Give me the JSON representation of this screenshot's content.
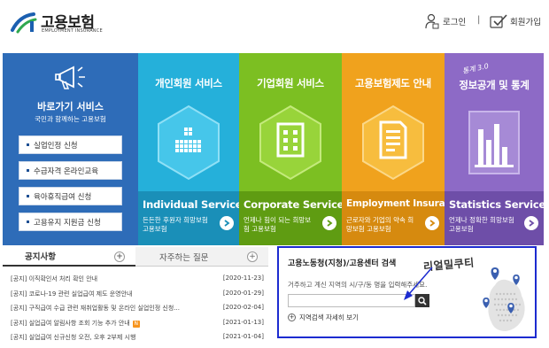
{
  "header": {
    "logo_title": "고용보험",
    "logo_sub": "EMPLOYMENT INSURANCE",
    "login_label": "로그인",
    "separator": "|",
    "join_label": "회원가입"
  },
  "quick": {
    "title": "바로가기 서비스",
    "subtitle": "국민과 함께하는 고용보험",
    "items": [
      {
        "label": "실업인정 신청"
      },
      {
        "label": "수급자격 온라인교육"
      },
      {
        "label": "육아휴직급여 신청"
      },
      {
        "label": "고용유지 지원금 신청"
      }
    ]
  },
  "panels": [
    {
      "title": "개인회원 서비스",
      "en_title": "Individual Service",
      "desc": "든든한 후원자 희망보험 고용보험"
    },
    {
      "title": "기업회원 서비스",
      "en_title": "Corporate Service",
      "desc": "언제나 힘이 되는 희망보험 고용보험"
    },
    {
      "title": "고용보험제도 안내",
      "en_title": "Employment Insurance",
      "desc": "근로자와 기업의 약속 희망보험 고용보험"
    },
    {
      "title": "정보공개 및 통계",
      "en_title": "Statistics Service",
      "desc": "언제나 정확한 희망보험 고용보험",
      "deco": "통계 3.0"
    }
  ],
  "tabs": {
    "notice": "공지사항",
    "faq": "자주하는 질문",
    "plus": "+"
  },
  "notices": [
    {
      "text": "[공지] 이직확인서 처리 확인 안내",
      "date": "[2020-11-23]",
      "is_new": false
    },
    {
      "text": "[공지] 코로나-19 관련 실업급여 제도 운영안내",
      "date": "[2020-01-29]",
      "is_new": false
    },
    {
      "text": "[공지] 구직급여 수급 관련 재취업활동 및 온라인 실업인정 신청...",
      "date": "[2020-02-04]",
      "is_new": false
    },
    {
      "text": "[공지] 실업급여 알림사항 조회 기능 추가 안내",
      "date": "[2021-01-13]",
      "is_new": true,
      "badge": "N"
    },
    {
      "text": "[공지] 실업급여 신규신청 오전, 오후 2부제 시행",
      "date": "[2021-01-04]",
      "is_new": false
    }
  ],
  "search": {
    "title": "고용노동청(지청)/고용센터 검색",
    "desc": "거주하고 계신 지역의 시/구/동 명을 입력해주세요.",
    "region_link": "지역검색 자세히 보기",
    "input_value": ""
  },
  "annotation": "리얼밀쿠티",
  "colors": {
    "quick": "#2e6cb8",
    "individual": "#25b0da",
    "corporate": "#7cbf22",
    "employment": "#f0a21d",
    "statistics": "#8d6ac6",
    "highlight_box": "#1c2bd0"
  }
}
